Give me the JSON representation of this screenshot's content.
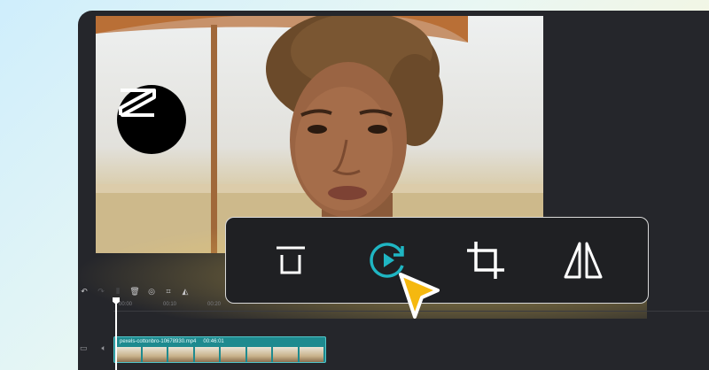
{
  "colors": {
    "accent": "#1fb6c3",
    "cursor": "#f5b80f",
    "window_bg": "#25262b"
  },
  "preview": {
    "logo_icon": "capcut-logo-icon"
  },
  "popup_toolbar": {
    "items": [
      {
        "name": "delete",
        "icon": "trash-icon"
      },
      {
        "name": "speed",
        "icon": "speed-play-icon",
        "active": true
      },
      {
        "name": "crop",
        "icon": "crop-icon"
      },
      {
        "name": "mirror",
        "icon": "mirror-icon"
      }
    ]
  },
  "timeline": {
    "ticks": [
      "00:00",
      "00:10",
      "00:20"
    ],
    "clip": {
      "filename": "pexels-cottonbro-10678930.mp4",
      "duration": "00:46:01"
    }
  }
}
